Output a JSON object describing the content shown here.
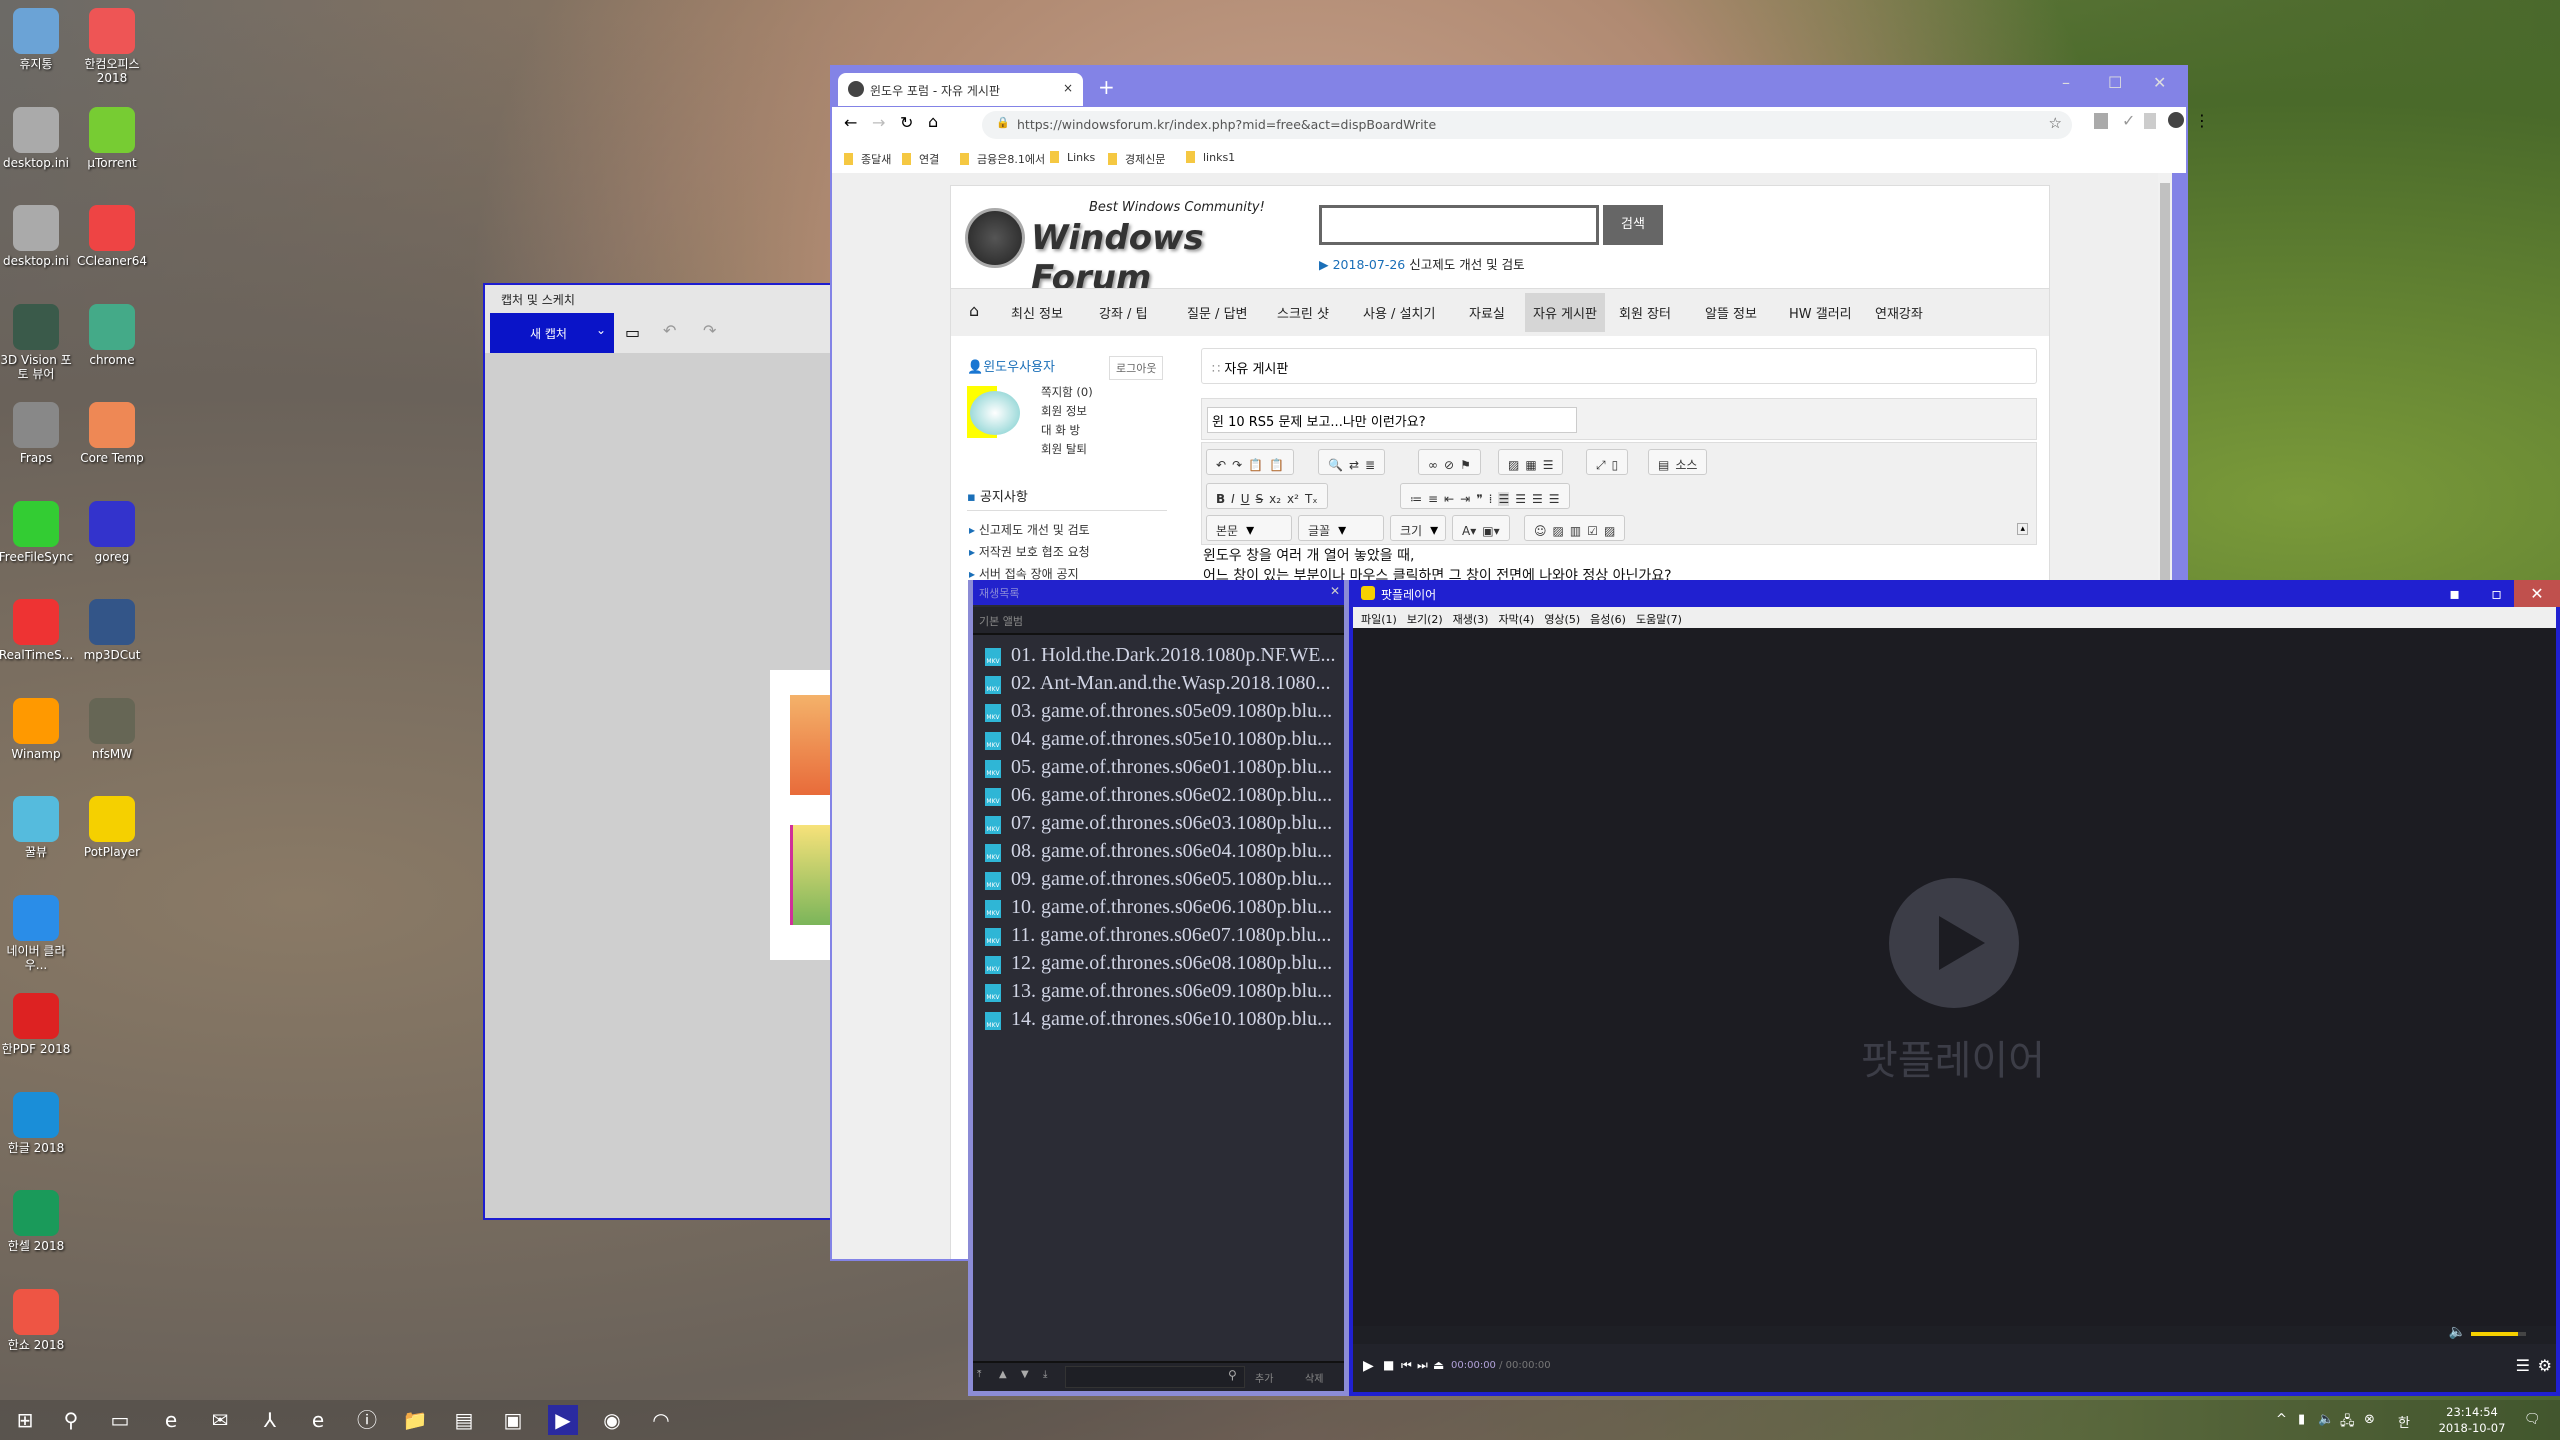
{
  "desktop": {
    "col1": [
      "휴지통",
      "desktop.ini",
      "desktop.ini",
      "3D Vision 포토 뷰어",
      "Fraps",
      "FreeFileSync",
      "RealTimeS...",
      "Winamp",
      "꿀뷰",
      "네이버 클라우...",
      "한PDF 2018",
      "한글 2018",
      "한셀 2018",
      "한쇼 2018"
    ],
    "col2": [
      "한컴오피스 2018",
      "µTorrent",
      "CCleaner64",
      "chrome",
      "Core Temp",
      "goreg",
      "mp3DCut",
      "nfsMW",
      "PotPlayer"
    ]
  },
  "capture": {
    "title": "캡처 및 스케치",
    "new_capture": "새 캡처"
  },
  "browser": {
    "tab_title": "윈도우 포럼 - 자유 게시판",
    "url": "https://windowsforum.kr/index.php?mid=free&act=dispBoardWrite",
    "bookmarks": [
      "종달새",
      "연결",
      "금융은8.1에서",
      "Links",
      "경제신문",
      "links1"
    ]
  },
  "forum": {
    "tagline": "Best Windows Community!",
    "logo": "Windows Forum",
    "search_button": "검색",
    "notice_date": "2018-07-26",
    "notice_text": "신고제도 개선 및 검토",
    "nav": [
      "최신 정보",
      "강좌 / 팁",
      "질문 / 답변",
      "스크린 샷",
      "사용 / 설치기",
      "자료실",
      "자유 게시판",
      "회원 장터",
      "알뜰 정보",
      "HW 갤러리",
      "연재강좌"
    ],
    "user": "윈도우사용자",
    "logout": "로그아웃",
    "user_links": [
      "쪽지함 (0)",
      "회원 정보",
      "대 화 방",
      "회원 탈퇴"
    ],
    "notice_heading": "공지사항",
    "notices": [
      "신고제도 개선 및 검토",
      "저작권 보호 협조 요청",
      "서버 접속 장애 공지"
    ],
    "board_title": "자유 게시판",
    "post_title": "윈 10 RS5 문제 보고...나만 이런가요?",
    "toolbar": {
      "source": "소스",
      "format": "본문",
      "font": "글꼴",
      "size": "크기"
    },
    "body_lines": [
      "윈도우 창을 여러 개 열어 놓았을 때,",
      "어느 창이 있는 부분이나 마우스 클릭하면 그 창이 전면에 나와야 정상 아닌가요?"
    ]
  },
  "playlist": {
    "title": "재생목록",
    "album": "기본 앨범",
    "add": "추가",
    "delete": "삭제",
    "items": [
      "01. Hold.the.Dark.2018.1080p.NF.WE...",
      "02. Ant-Man.and.the.Wasp.2018.1080...",
      "03. game.of.thrones.s05e09.1080p.blu...",
      "04. game.of.thrones.s05e10.1080p.blu...",
      "05. game.of.thrones.s06e01.1080p.blu...",
      "06. game.of.thrones.s06e02.1080p.blu...",
      "07. game.of.thrones.s06e03.1080p.blu...",
      "08. game.of.thrones.s06e04.1080p.blu...",
      "09. game.of.thrones.s06e05.1080p.blu...",
      "10. game.of.thrones.s06e06.1080p.blu...",
      "11. game.of.thrones.s06e07.1080p.blu...",
      "12. game.of.thrones.s06e08.1080p.blu...",
      "13. game.of.thrones.s06e09.1080p.blu...",
      "14. game.of.thrones.s06e10.1080p.blu..."
    ]
  },
  "player": {
    "title": "팟플레이어",
    "menu": [
      "파일(1)",
      "보기(2)",
      "재생(3)",
      "자막(4)",
      "영상(5)",
      "음성(6)",
      "도움말(7)"
    ],
    "logo_text": "팟플레이어",
    "time_current": "00:00:00",
    "time_total": "00:00:00",
    "volume": 0.85
  },
  "taskbar": {
    "icons": [
      "start-icon",
      "search-icon",
      "task-view-icon",
      "edge-icon",
      "mail-icon",
      "acrobat-icon",
      "ie-icon",
      "info-icon",
      "file-explorer-icon",
      "notes-icon",
      "monitor-icon",
      "potplayer-icon",
      "chrome-icon",
      "photo-icon"
    ],
    "time": "23:14:54",
    "date": "2018-10-07",
    "ime": "한"
  }
}
